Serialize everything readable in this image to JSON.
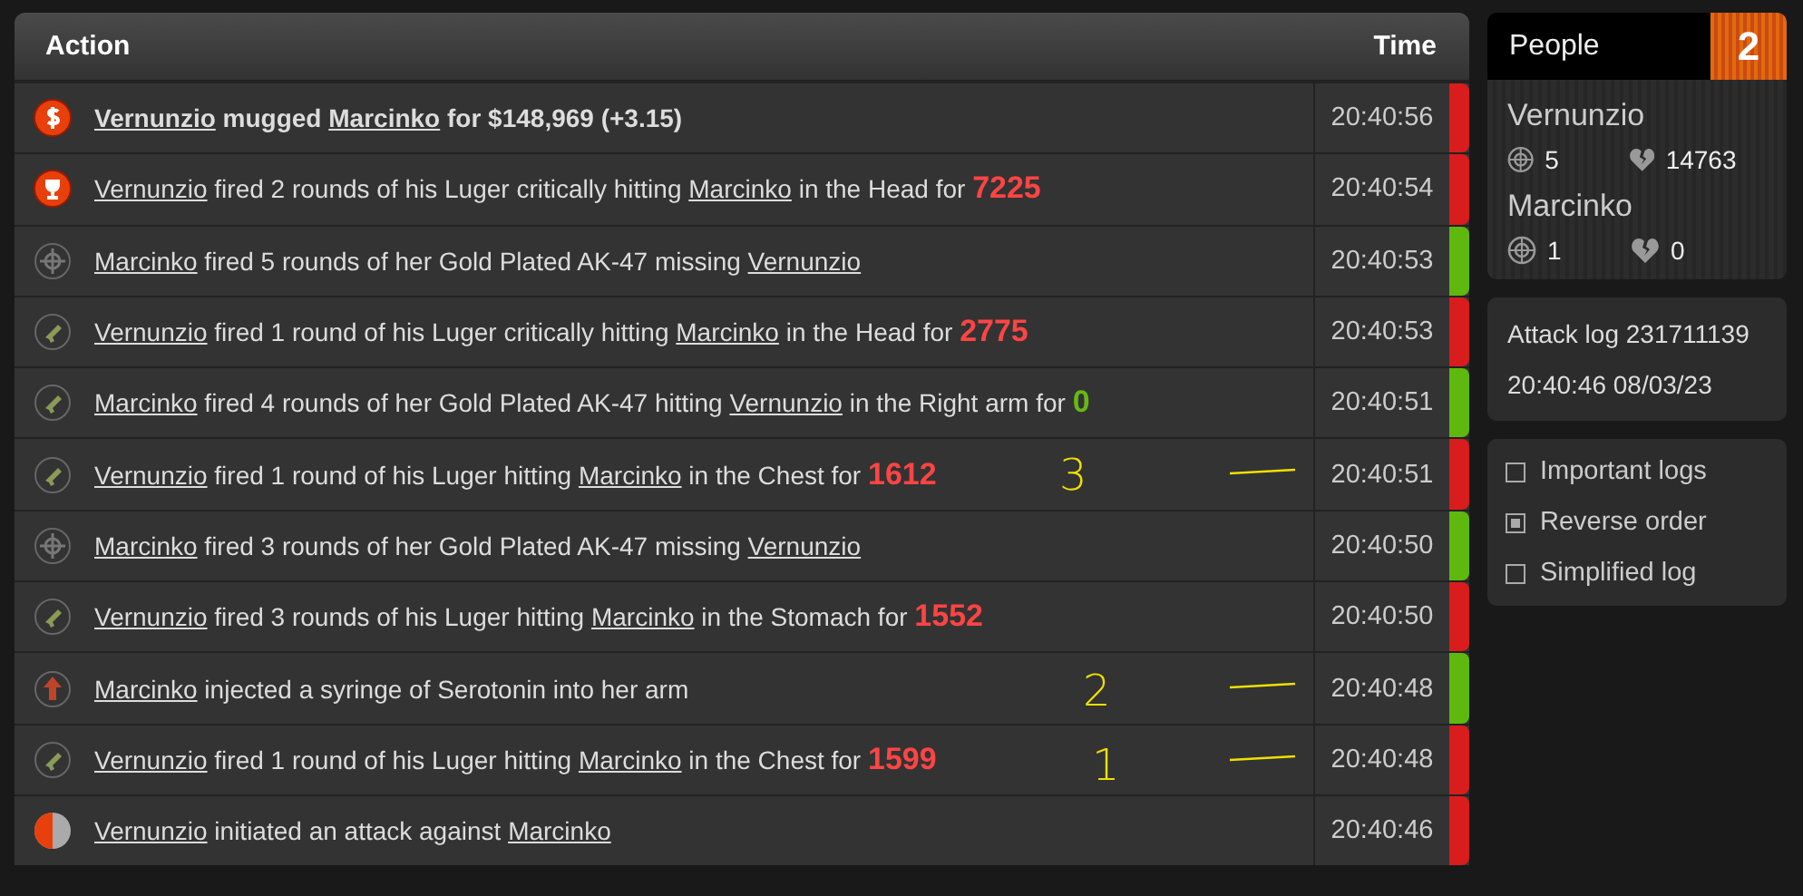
{
  "log": {
    "columns": [
      "Action",
      "Time"
    ],
    "rows": [
      {
        "kind": "mug",
        "bold": true,
        "color": "#d91c1c",
        "time": "20:40:56",
        "parts": [
          {
            "kind": "player",
            "text": "Vernunzio"
          },
          {
            "kind": "text",
            "text": " mugged "
          },
          {
            "kind": "player",
            "text": "Marcinko"
          },
          {
            "kind": "text",
            "text": " for $148,969 (+3.15)"
          }
        ]
      },
      {
        "kind": "critical",
        "bold": false,
        "color": "#d91c1c",
        "time": "20:40:54",
        "parts": [
          {
            "kind": "player",
            "text": "Vernunzio"
          },
          {
            "kind": "text",
            "text": " fired 2 rounds of his Luger critically hitting "
          },
          {
            "kind": "player",
            "text": "Marcinko"
          },
          {
            "kind": "text",
            "text": " in the Head for "
          },
          {
            "kind": "damage",
            "text": "7225",
            "color": "#ff4444"
          }
        ]
      },
      {
        "kind": "miss",
        "bold": false,
        "color": "#5eb80e",
        "time": "20:40:53",
        "parts": [
          {
            "kind": "player",
            "text": "Marcinko"
          },
          {
            "kind": "text",
            "text": " fired 5 rounds of her Gold Plated AK-47 missing "
          },
          {
            "kind": "player",
            "text": "Vernunzio"
          }
        ]
      },
      {
        "kind": "hit",
        "bold": false,
        "color": "#d91c1c",
        "time": "20:40:53",
        "parts": [
          {
            "kind": "player",
            "text": "Vernunzio"
          },
          {
            "kind": "text",
            "text": " fired 1 round of his Luger critically hitting "
          },
          {
            "kind": "player",
            "text": "Marcinko"
          },
          {
            "kind": "text",
            "text": " in the Head for "
          },
          {
            "kind": "damage",
            "text": "2775",
            "color": "#ff4444"
          }
        ]
      },
      {
        "kind": "hit",
        "bold": false,
        "color": "#5eb80e",
        "time": "20:40:51",
        "parts": [
          {
            "kind": "player",
            "text": "Marcinko"
          },
          {
            "kind": "text",
            "text": " fired 4 rounds of her Gold Plated AK-47 hitting "
          },
          {
            "kind": "player",
            "text": "Vernunzio"
          },
          {
            "kind": "text",
            "text": " in the Right arm for "
          },
          {
            "kind": "damage",
            "text": "0",
            "color": "#66b814"
          }
        ]
      },
      {
        "kind": "hit",
        "bold": false,
        "color": "#d91c1c",
        "time": "20:40:51",
        "annotation": "3",
        "parts": [
          {
            "kind": "player",
            "text": "Vernunzio"
          },
          {
            "kind": "text",
            "text": " fired 1 round of his Luger hitting "
          },
          {
            "kind": "player",
            "text": "Marcinko"
          },
          {
            "kind": "text",
            "text": " in the Chest for "
          },
          {
            "kind": "damage",
            "text": "1612",
            "color": "#ff4444"
          }
        ]
      },
      {
        "kind": "miss",
        "bold": false,
        "color": "#5eb80e",
        "time": "20:40:50",
        "parts": [
          {
            "kind": "player",
            "text": "Marcinko"
          },
          {
            "kind": "text",
            "text": " fired 3 rounds of her Gold Plated AK-47 missing "
          },
          {
            "kind": "player",
            "text": "Vernunzio"
          }
        ]
      },
      {
        "kind": "hit",
        "bold": false,
        "color": "#d91c1c",
        "time": "20:40:50",
        "parts": [
          {
            "kind": "player",
            "text": "Vernunzio"
          },
          {
            "kind": "text",
            "text": " fired 3 rounds of his Luger hitting "
          },
          {
            "kind": "player",
            "text": "Marcinko"
          },
          {
            "kind": "text",
            "text": " in the Stomach for "
          },
          {
            "kind": "damage",
            "text": "1552",
            "color": "#ff4444"
          }
        ]
      },
      {
        "kind": "boost",
        "bold": false,
        "color": "#5eb80e",
        "time": "20:40:48",
        "annotation": "2",
        "parts": [
          {
            "kind": "player",
            "text": "Marcinko"
          },
          {
            "kind": "text",
            "text": " injected a syringe of Serotonin into her arm"
          }
        ]
      },
      {
        "kind": "hit",
        "bold": false,
        "color": "#d91c1c",
        "time": "20:40:48",
        "annotation": "1",
        "parts": [
          {
            "kind": "player",
            "text": "Vernunzio"
          },
          {
            "kind": "text",
            "text": " fired 1 round of his Luger hitting "
          },
          {
            "kind": "player",
            "text": "Marcinko"
          },
          {
            "kind": "text",
            "text": " in the Chest for "
          },
          {
            "kind": "damage",
            "text": "1599",
            "color": "#ff4444"
          }
        ]
      },
      {
        "kind": "start",
        "bold": false,
        "color": "#d91c1c",
        "time": "20:40:46",
        "parts": [
          {
            "kind": "player",
            "text": "Vernunzio"
          },
          {
            "kind": "text",
            "text": " initiated an attack against "
          },
          {
            "kind": "player",
            "text": "Marcinko"
          }
        ]
      }
    ]
  },
  "people": {
    "title": "People",
    "count": "2",
    "players": [
      {
        "name": "Vernunzio",
        "hits": "5",
        "damage": "14763"
      },
      {
        "name": "Marcinko",
        "hits": "1",
        "damage": "0"
      }
    ]
  },
  "info": {
    "title": "Attack log 231711139",
    "datetime": "20:40:46 08/03/23"
  },
  "options": [
    {
      "label": "Important logs",
      "checked": false
    },
    {
      "label": "Reverse order",
      "checked": true
    },
    {
      "label": "Simplified log",
      "checked": false
    }
  ]
}
